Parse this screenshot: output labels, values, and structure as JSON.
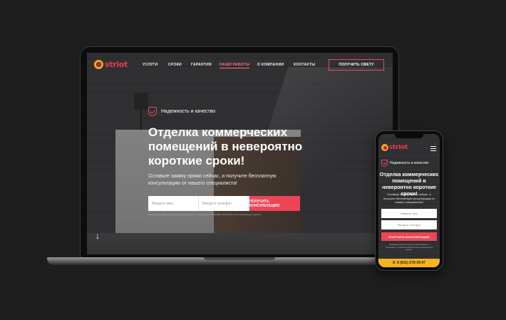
{
  "brand": {
    "name": "striot",
    "accent": "#ef4456",
    "logo_orange": "#f5a623",
    "phone_bar_color": "#f5b321"
  },
  "nav": {
    "items": [
      {
        "label": "УСЛУГИ",
        "active": false
      },
      {
        "label": "СРОКИ",
        "active": false
      },
      {
        "label": "ГАРАНТИЯ",
        "active": false
      },
      {
        "label": "НАШИ РАБОТЫ",
        "active": true
      },
      {
        "label": "О КОМПАНИИ",
        "active": false
      },
      {
        "label": "КОНТАКТЫ",
        "active": false
      }
    ],
    "cta_label": "ПОЛУЧИТЬ СМЕТУ"
  },
  "hero": {
    "tagline": "Надежность и качество",
    "title": "Отделка коммерческих помещений в невероятно короткие сроки!",
    "subtitle": "Оставьте заявку прямо сейчас, и получите бесплатную консультацию от нашего специалиста!",
    "name_placeholder": "Введите имя",
    "phone_placeholder": "Введите телефон",
    "submit_label": "ПОЛУЧИТЬ КОНСУЛЬТАЦИЮ",
    "note": "Нажимая на кнопку «Получить консультацию» я соглашаюсь с условиями обработки моих персональных данных",
    "scroll_icon": "arrow-down-icon"
  },
  "mobile": {
    "tagline": "Надежность и качество",
    "title": "Отделка коммерческих помещений в невероятно короткие сроки!",
    "subtitle": "Оставьте заявку прямо сейчас, и получите бесплатную консультацию от нашего специалиста!",
    "name_placeholder": "Введите имя",
    "phone_placeholder": "Введите телефон",
    "submit_label": "ПОЛУЧИТЬ КОНСУЛЬТАЦИЮ",
    "note": "Нажимая на кнопку «Получить консультацию» я соглашаюсь с условиями обработки моих персональных данных",
    "phone_number": "8 (831) 278-39-97",
    "menu_icon": "hamburger-menu-icon"
  }
}
